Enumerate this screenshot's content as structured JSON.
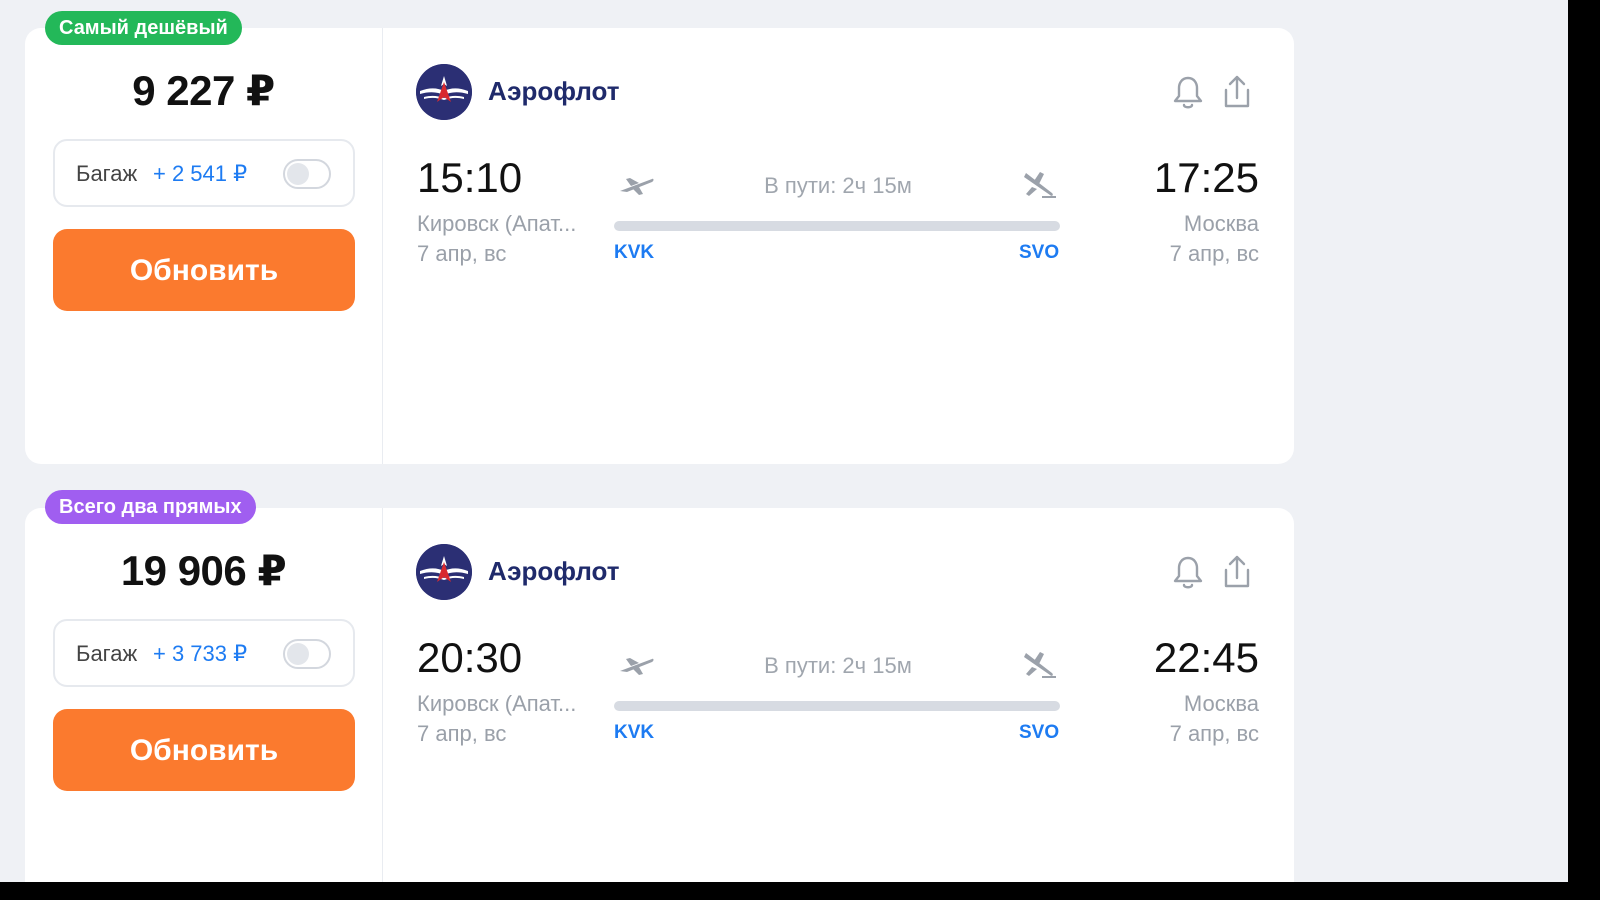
{
  "colors": {
    "badge_cheapest": "#23b859",
    "badge_direct": "#a05ef0",
    "update_button": "#fb7a2e",
    "accent_blue": "#1d7bf2",
    "airline_brand": "#2b2f74"
  },
  "tickets": [
    {
      "badge": "Самый дешёвый",
      "price": "9 227 ₽",
      "baggage": {
        "label": "Багаж",
        "price": "+ 2 541 ₽",
        "enabled": false
      },
      "update_label": "Обновить",
      "airline": {
        "name": "Аэрофлот",
        "logo_icon": "aeroflot-logo-icon"
      },
      "actions": {
        "subscribe_icon": "bell-icon",
        "share_icon": "share-icon"
      },
      "departure": {
        "time": "15:10",
        "city": "Кировск (Апат...",
        "date": "7 апр, вс",
        "iata": "KVK"
      },
      "arrival": {
        "time": "17:25",
        "city": "Москва",
        "date": "7 апр, вс",
        "iata": "SVO"
      },
      "duration": "В пути: 2ч 15м"
    },
    {
      "badge": "Всего два прямых",
      "price": "19 906 ₽",
      "baggage": {
        "label": "Багаж",
        "price": "+ 3 733 ₽",
        "enabled": false
      },
      "update_label": "Обновить",
      "airline": {
        "name": "Аэрофлот",
        "logo_icon": "aeroflot-logo-icon"
      },
      "actions": {
        "subscribe_icon": "bell-icon",
        "share_icon": "share-icon"
      },
      "departure": {
        "time": "20:30",
        "city": "Кировск (Апат...",
        "date": "7 апр, вс",
        "iata": "KVK"
      },
      "arrival": {
        "time": "22:45",
        "city": "Москва",
        "date": "7 апр, вс",
        "iata": "SVO"
      },
      "duration": "В пути: 2ч 15м"
    }
  ]
}
